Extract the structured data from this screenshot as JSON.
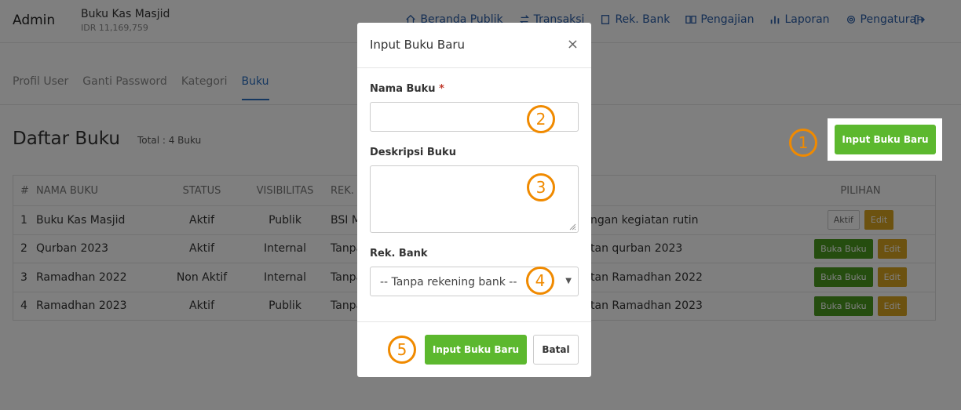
{
  "header": {
    "brand": "Admin",
    "kas_title": "Buku Kas Masjid",
    "kas_balance": "IDR 11,169,759",
    "nav": [
      {
        "label": "Beranda Publik",
        "icon": "home-icon"
      },
      {
        "label": "Transaksi",
        "icon": "transfer-icon"
      },
      {
        "label": "Rek. Bank",
        "icon": "book-icon"
      },
      {
        "label": "Pengajian",
        "icon": "open-book-icon"
      },
      {
        "label": "Laporan",
        "icon": "bar-chart-icon"
      },
      {
        "label": "Pengaturan",
        "icon": "gear-icon"
      }
    ],
    "logout_icon": "logout-icon"
  },
  "tabs": [
    "Profil User",
    "Ganti Password",
    "Kategori",
    "Buku"
  ],
  "active_tab": "Buku",
  "page": {
    "title": "Daftar Buku",
    "total": "Total : 4 Buku",
    "input_button": "Input Buku Baru"
  },
  "table": {
    "headers": [
      "#",
      "NAMA BUKU",
      "STATUS",
      "VISIBILITAS",
      "REK.",
      "PILIHAN"
    ],
    "rows": [
      {
        "no": "1",
        "name": "Buku Kas Masjid",
        "status": "Aktif",
        "visibility": "Publik",
        "rek": "BSI M",
        "desc": "ngan kegiatan rutin",
        "actions": [
          {
            "label": "Aktif",
            "style": "grey"
          },
          {
            "label": "Edit",
            "style": "yellow"
          }
        ]
      },
      {
        "no": "2",
        "name": "Qurban 2023",
        "status": "Aktif",
        "visibility": "Internal",
        "rek": "Tanpa",
        "desc": "tan qurban 2023",
        "actions": [
          {
            "label": "Buka Buku",
            "style": "green"
          },
          {
            "label": "Edit",
            "style": "yellow"
          }
        ]
      },
      {
        "no": "3",
        "name": "Ramadhan 2022",
        "status": "Non Aktif",
        "visibility": "Internal",
        "rek": "Tanpa",
        "desc": "tan Ramadhan 2022",
        "actions": [
          {
            "label": "Buka Buku",
            "style": "green"
          },
          {
            "label": "Edit",
            "style": "yellow"
          }
        ]
      },
      {
        "no": "4",
        "name": "Ramadhan 2023",
        "status": "Aktif",
        "visibility": "Publik",
        "rek": "Tanpa",
        "desc": "tan Ramadhan 2023",
        "actions": [
          {
            "label": "Buka Buku",
            "style": "green"
          },
          {
            "label": "Edit",
            "style": "yellow"
          }
        ]
      }
    ]
  },
  "modal": {
    "title": "Input Buku Baru",
    "close": "×",
    "name_label": "Nama Buku",
    "required_mark": "*",
    "name_value": "",
    "desc_label": "Deskripsi Buku",
    "desc_value": "",
    "bank_label": "Rek. Bank",
    "bank_selected": "-- Tanpa rekening bank --",
    "submit": "Input Buku Baru",
    "cancel": "Batal"
  },
  "markers": [
    "1",
    "2",
    "3",
    "4",
    "5"
  ],
  "colors": {
    "accent": "#2b6fc0",
    "primary_button": "#5cb82e",
    "marker": "#f08a00",
    "edit_button": "#d9a520"
  }
}
